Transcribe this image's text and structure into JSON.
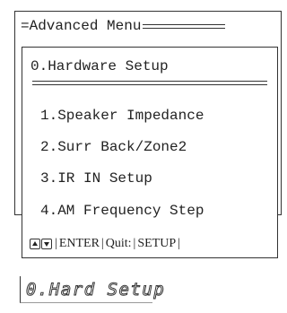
{
  "back_menu": {
    "title": "=Advanced Menu"
  },
  "front_menu": {
    "title": "0.Hardware Setup",
    "items": [
      "1.Speaker Impedance",
      "2.Surr Back/Zone2",
      "3.IR IN Setup",
      "4.AM Frequency Step"
    ],
    "footer": {
      "up_icon": "up-arrow-key-icon",
      "down_icon": "down-arrow-key-icon",
      "enter_label": "ENTER",
      "quit_label": "Quit:",
      "setup_label": "SETUP"
    }
  },
  "display": {
    "text": "0.Hard Setup"
  }
}
